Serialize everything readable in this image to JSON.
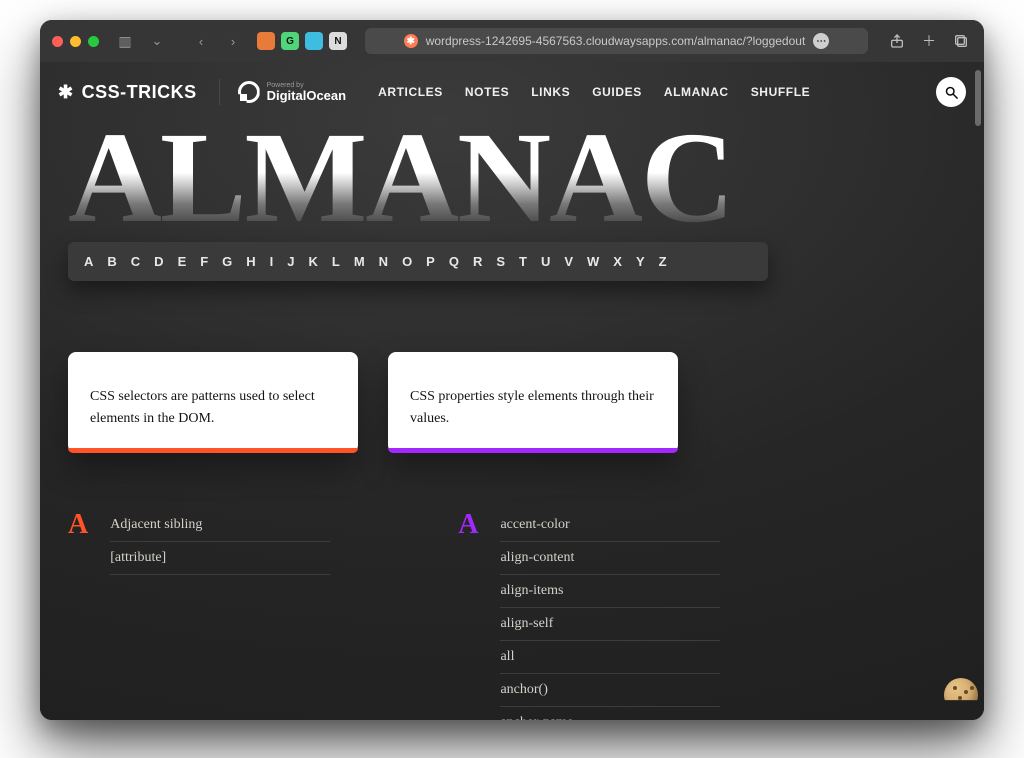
{
  "browser": {
    "url": "wordpress-1242695-4567563.cloudwaysapps.com/almanac/?loggedout"
  },
  "header": {
    "brand": "CSS-TRICKS",
    "powered_by_small": "Powered by",
    "powered_by_name": "DigitalOcean",
    "nav": [
      "ARTICLES",
      "NOTES",
      "LINKS",
      "GUIDES",
      "ALMANAC",
      "SHUFFLE"
    ]
  },
  "hero": {
    "title": "ALMANAC",
    "az": [
      "A",
      "B",
      "C",
      "D",
      "E",
      "F",
      "G",
      "H",
      "I",
      "J",
      "K",
      "L",
      "M",
      "N",
      "O",
      "P",
      "Q",
      "R",
      "S",
      "T",
      "U",
      "V",
      "W",
      "X",
      "Y",
      "Z"
    ]
  },
  "cards": {
    "selectors": "CSS selectors are patterns used to select elements in the DOM.",
    "properties": "CSS properties style elements through their values."
  },
  "lists": {
    "selectors_letter": "A",
    "selectors_items": [
      "Adjacent sibling",
      "[attribute]"
    ],
    "properties_letter": "A",
    "properties_items": [
      "accent-color",
      "align-content",
      "align-items",
      "align-self",
      "all",
      "anchor()",
      "anchor-name"
    ]
  }
}
